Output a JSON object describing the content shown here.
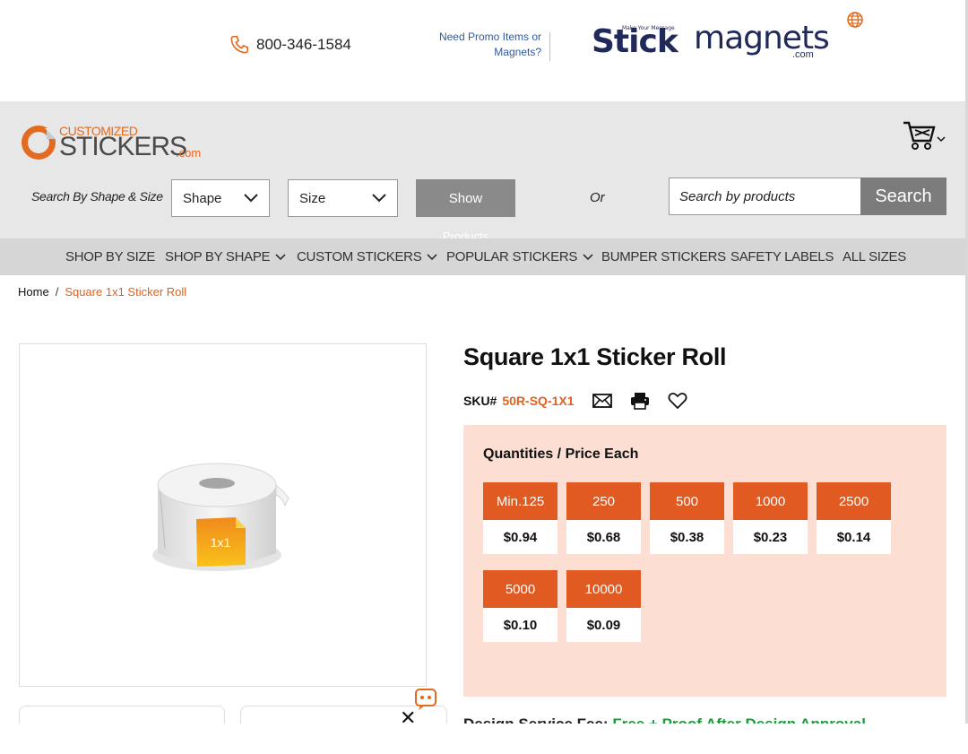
{
  "topbar": {
    "phone": "800-346-1584",
    "promo_line1": "Need Promo Items or",
    "promo_line2": "Magnets?",
    "stick_logo": "Stick",
    "stick_tagline": "Make Your Message",
    "magnets_logo": "magnets",
    "magnets_com": ".com"
  },
  "header": {
    "logo_line1": "CUSTOMIZED",
    "logo_line2": "STICKERS",
    "logo_line3": ".com",
    "search_by_label": "Search By Shape & Size",
    "shape_select": "Shape",
    "size_select": "Size",
    "show_label": "Show",
    "show_label2": "Products",
    "or_label": "Or",
    "search_placeholder": "Search by products",
    "search_button": "Search"
  },
  "nav": {
    "items": [
      {
        "label": "SHOP BY SIZE",
        "dropdown": false
      },
      {
        "label": "SHOP BY SHAPE",
        "dropdown": true
      },
      {
        "label": "CUSTOM STICKERS",
        "dropdown": true
      },
      {
        "label": "POPULAR STICKERS",
        "dropdown": true
      },
      {
        "label": "BUMPER STICKERS",
        "dropdown": false
      },
      {
        "label": "SAFETY LABELS",
        "dropdown": false
      },
      {
        "label": "ALL SIZES",
        "dropdown": false
      }
    ]
  },
  "breadcrumb": {
    "home": "Home",
    "separator": "/",
    "current": "Square 1x1 Sticker Roll"
  },
  "product": {
    "title": "Square 1x1 Sticker Roll",
    "sku_label": "SKU#",
    "sku": "50R-SQ-1X1",
    "image_label": "1x1",
    "pricing_title": "Quantities / Price Each",
    "tiers": [
      {
        "qty": "Min.125",
        "price": "$0.94"
      },
      {
        "qty": "250",
        "price": "$0.68"
      },
      {
        "qty": "500",
        "price": "$0.38"
      },
      {
        "qty": "1000",
        "price": "$0.23"
      },
      {
        "qty": "2500",
        "price": "$0.14"
      },
      {
        "qty": "5000",
        "price": "$0.10"
      },
      {
        "qty": "10000",
        "price": "$0.09"
      }
    ],
    "bottom_text": "Design Service Fee:",
    "bottom_green": "Free + Proof After Design Approval"
  },
  "colors": {
    "accent": "#e05a22",
    "price_panel_bg": "#fcded3",
    "header_bg": "#e7e7e7",
    "nav_bg": "#d6d6d6"
  }
}
